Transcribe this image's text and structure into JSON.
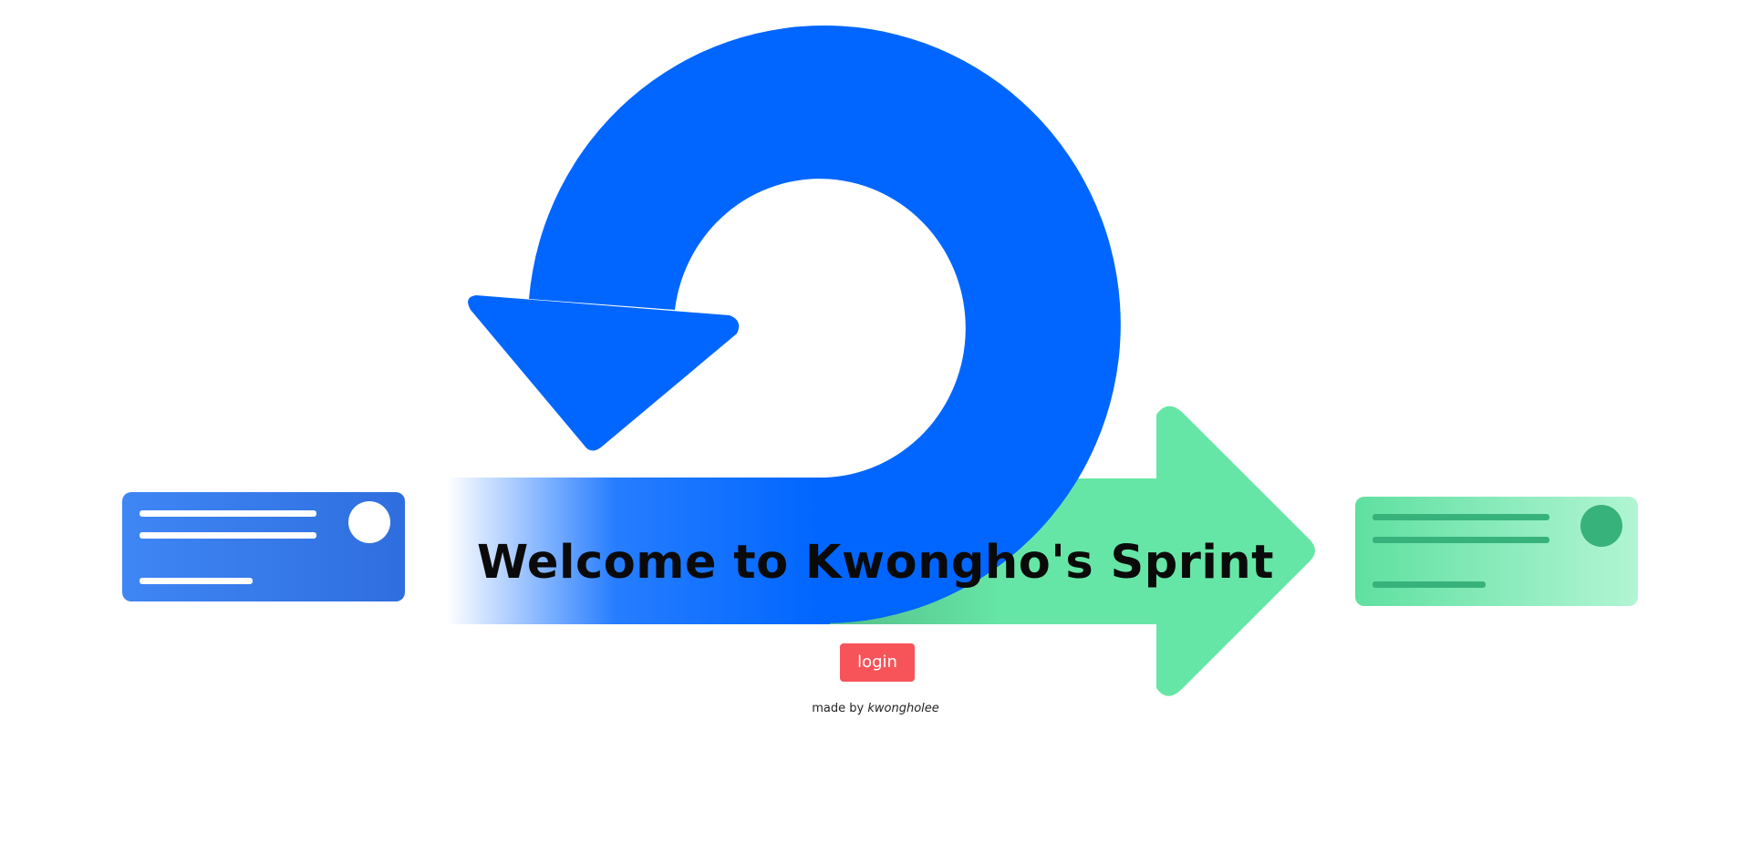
{
  "hero": {
    "title": "Welcome to Kwongho's Sprint",
    "login_label": "login",
    "credit_prefix": "made by",
    "credit_author": "kwongholee"
  },
  "colors": {
    "sprint_blue": "#0066ff",
    "sprint_green": "#66e6a6",
    "card_blue": "#3a7be6",
    "card_green": "#7ee8b6",
    "login_red": "#f7545a"
  },
  "icons": [
    "sprint-cycle-arrow-icon",
    "backlog-card-icon",
    "done-card-icon",
    "forward-arrow-icon"
  ]
}
